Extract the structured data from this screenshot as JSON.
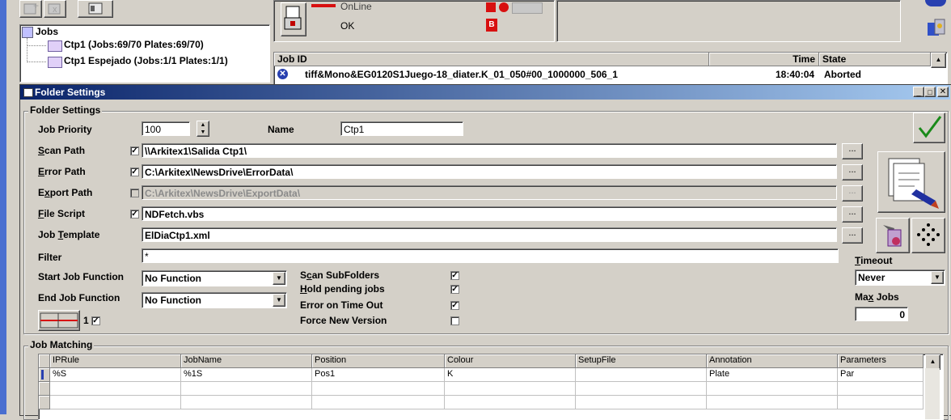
{
  "top": {
    "tree_root": "Jobs",
    "tree_items": [
      "Ctp1 (Jobs:69/70  Plates:69/70)",
      "Ctp1 Espejado (Jobs:1/1  Plates:1/1)"
    ],
    "status_line": "OnLine",
    "status_ok": "OK",
    "status_badge": "B",
    "job_table": {
      "headers": [
        "Job ID",
        "Time",
        "State"
      ],
      "row": {
        "job_id": "tiff&Mono&EG0120S1Juego-18_diater.K_01_050#00_1000000_506_1",
        "time": "18:40:04",
        "state": "Aborted"
      }
    }
  },
  "dialog": {
    "title": "Folder Settings",
    "group_title": "Folder Settings",
    "labels": {
      "job_priority": "Job Priority",
      "name": "Name",
      "scan_path": "Scan Path",
      "error_path": "Error Path",
      "export_path": "Export Path",
      "file_script": "File Script",
      "job_template": "Job Template",
      "filter": "Filter",
      "start_job_function": "Start Job Function",
      "end_job_function": "End Job Function",
      "scan_subfolders": "Scan SubFolders",
      "hold_pending_jobs": "Hold pending jobs",
      "error_on_time_out": "Error on Time Out",
      "force_new_version": "Force New Version",
      "timeout": "Timeout",
      "max_jobs": "Max Jobs"
    },
    "values": {
      "job_priority": "100",
      "name": "Ctp1",
      "scan_path": "\\\\Arkitex1\\Salida Ctp1\\",
      "error_path": "C:\\Arkitex\\NewsDrive\\ErrorData\\",
      "export_path": "C:\\Arkitex\\NewsDrive\\ExportData\\",
      "file_script": "NDFetch.vbs",
      "job_template": "ElDiaCtp1.xml",
      "filter": "*",
      "start_job_function": "No Function",
      "end_job_function": "No Function",
      "timeout": "Never",
      "max_jobs": "0",
      "counter": "1"
    },
    "browse_label": "...",
    "checks": {
      "scan_path": true,
      "error_path": true,
      "export_path": false,
      "file_script": true,
      "scan_subfolders": true,
      "hold_pending_jobs": true,
      "error_on_time_out": true,
      "force_new_version": false,
      "counter": true
    },
    "job_matching": {
      "title": "Job Matching",
      "headers": [
        "IPRule",
        "JobName",
        "Position",
        "Colour",
        "SetupFile",
        "Annotation",
        "Parameters"
      ],
      "rows": [
        [
          "%S",
          "%1S",
          "Pos1",
          "K",
          "",
          "Plate",
          "Par"
        ]
      ]
    }
  },
  "colors": {
    "title_bar_start": "#0a246a",
    "title_bar_end": "#a6caf0",
    "accept_green": "#1a8a1a",
    "status_red": "#d81010"
  }
}
